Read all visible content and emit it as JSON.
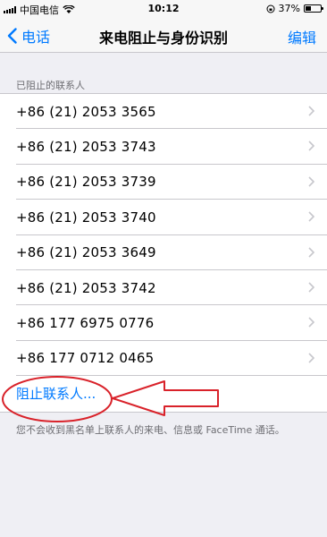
{
  "status_bar": {
    "carrier": "中国电信",
    "time": "10:12",
    "battery": "37%"
  },
  "nav": {
    "back_label": "电话",
    "title": "来电阻止与身份识别",
    "edit_label": "编辑"
  },
  "section_header": "已阻止的联系人",
  "blocked_contacts": [
    "+86 (21) 2053 3565",
    "+86 (21) 2053 3743",
    "+86 (21) 2053 3739",
    "+86 (21) 2053 3740",
    "+86 (21) 2053 3649",
    "+86 (21) 2053 3742",
    "+86 177 6975 0776",
    "+86 177 0712 0465"
  ],
  "block_contact_label": "阻止联系人...",
  "footer_note": "您不会收到黑名单上联系人的来电、信息或 FaceTime 通话。",
  "colors": {
    "accent": "#007aff",
    "annotation": "#d9222a"
  }
}
